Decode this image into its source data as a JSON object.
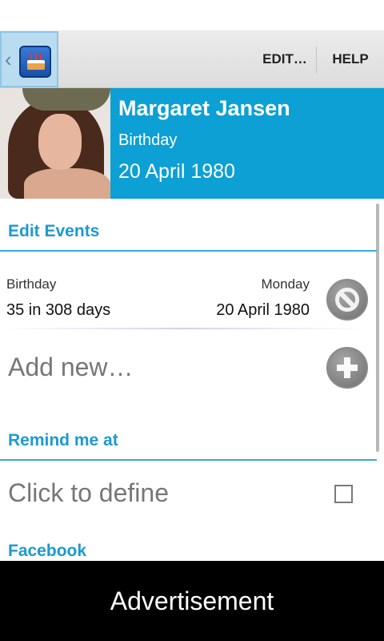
{
  "action_bar": {
    "up_icon": "cake-app-icon",
    "edit_label": "EDIT…",
    "help_label": "HELP"
  },
  "contact": {
    "name": "Margaret Jansen",
    "event_type": "Birthday",
    "date": "20 April 1980"
  },
  "colors": {
    "accent": "#0ca0d4",
    "section_title": "#1c9ad0"
  },
  "edit_events": {
    "title": "Edit Events",
    "events": [
      {
        "type": "Birthday",
        "weekday": "Monday",
        "countdown": "35 in 308 days",
        "date": "20 April 1980",
        "action_icon": "delete-icon"
      }
    ],
    "add_new": "Add new…",
    "add_icon": "add-icon"
  },
  "remind": {
    "title": "Remind me at",
    "value": "Click to define",
    "checked": false
  },
  "facebook": {
    "title": "Facebook"
  },
  "ad": {
    "label": "Advertisement"
  }
}
